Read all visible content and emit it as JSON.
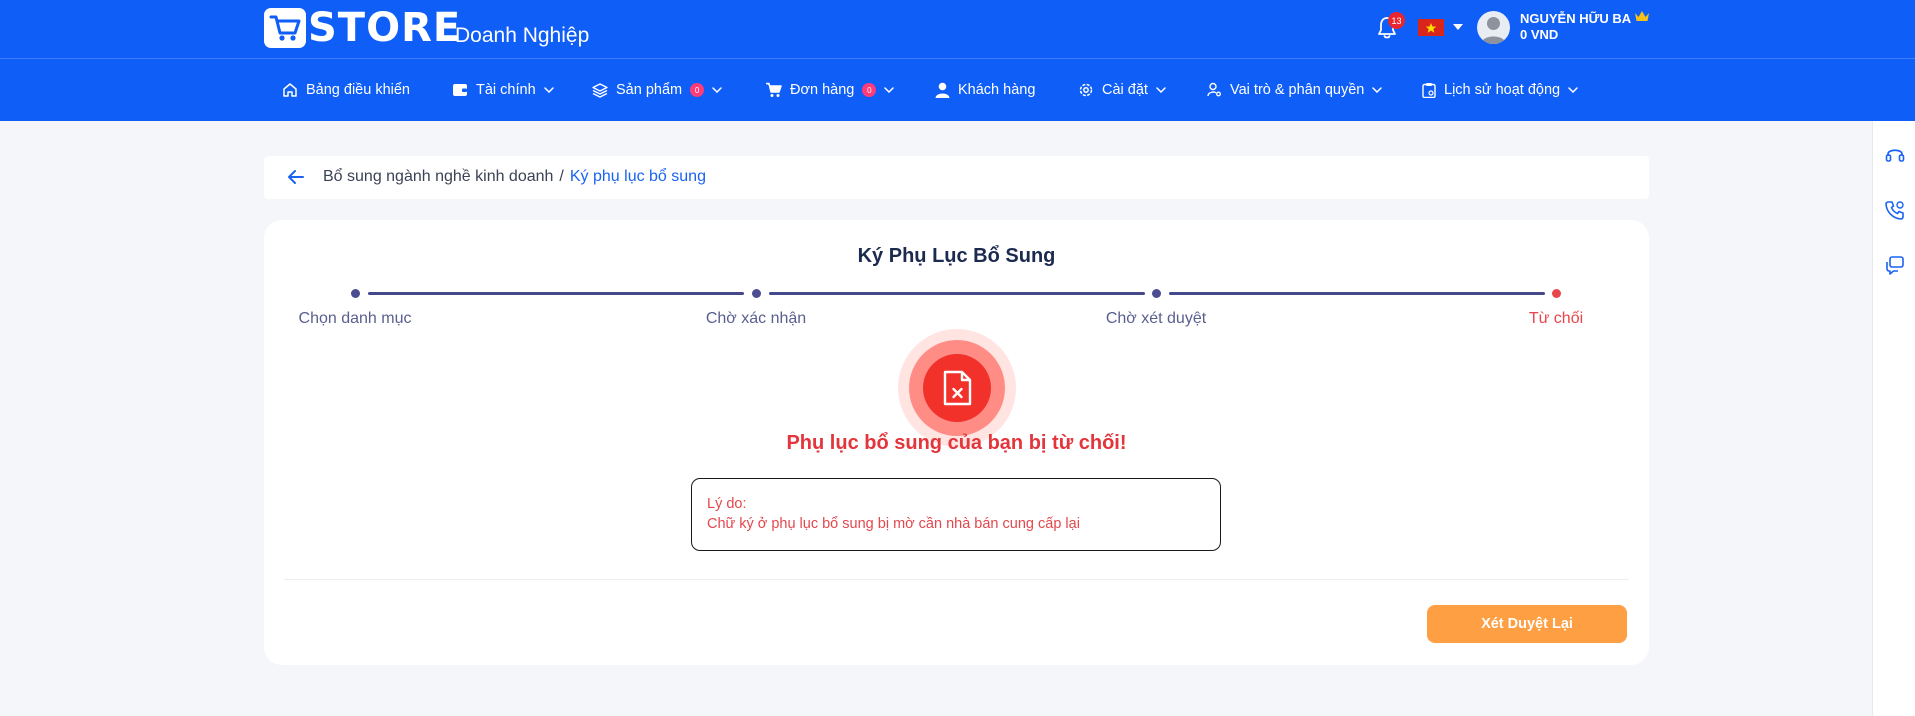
{
  "header": {
    "logo_text": "STORE",
    "brand_sub": "Doanh Nghiệp",
    "notification_count": "13",
    "user_name": "NGUYỄN HỮU BA",
    "balance": "0 VND",
    "icons": [
      "cart-logo-icon",
      "bell-icon",
      "vietnam-flag-icon",
      "caret-down-icon",
      "avatar-icon",
      "crown-icon"
    ]
  },
  "nav": {
    "items": [
      {
        "label": "Bảng điều khiển",
        "icon": "home-icon"
      },
      {
        "label": "Tài chính",
        "icon": "wallet-icon"
      },
      {
        "label": "Sản phẩm",
        "icon": "layers-icon",
        "badge": "0"
      },
      {
        "label": "Đơn hàng",
        "icon": "cart-icon",
        "badge": "0"
      },
      {
        "label": "Khách hàng",
        "icon": "user-icon"
      },
      {
        "label": "Cài đặt",
        "icon": "gear-icon"
      },
      {
        "label": "Vai trò & phân quyền",
        "icon": "user-key-icon"
      },
      {
        "label": "Lịch sử hoạt động",
        "icon": "clipboard-icon"
      }
    ]
  },
  "rail": {
    "icons": [
      "headset-icon",
      "phone-icon",
      "chat-icon"
    ]
  },
  "breadcrumb": {
    "parent": "Bổ sung ngành nghề kinh doanh",
    "separator": "/",
    "current": "Ký phụ lục bổ sung"
  },
  "page": {
    "title": "Ký Phụ Lục Bổ Sung",
    "steps": [
      {
        "label": "Chọn danh mục",
        "state": "done"
      },
      {
        "label": "Chờ xác nhận",
        "state": "done"
      },
      {
        "label": "Chờ xét duyệt",
        "state": "done"
      },
      {
        "label": "Từ chối",
        "state": "rejected"
      }
    ],
    "reject_message": "Phụ lục bổ sung của bạn bị từ chối!",
    "reason_label": "Lý do:",
    "reason_text": "Chữ ký ở phụ lục bổ sung bị mờ cần nhà bán cung cấp lại",
    "review_button": "Xét Duyệt Lại"
  },
  "colors": {
    "primary": "#0f5ef7",
    "step": "#4a4d8f",
    "rejected": "#e3353b",
    "button": "#ff9f43"
  }
}
